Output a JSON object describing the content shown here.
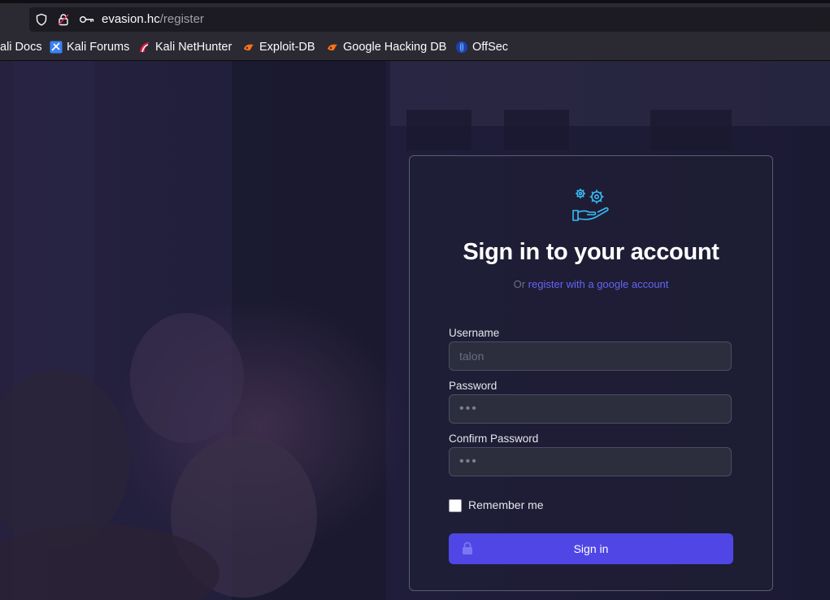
{
  "browser": {
    "url_host": "evasion.hc",
    "url_path": "/register",
    "bookmarks": [
      {
        "label": "ali Docs",
        "icon": "kali-docs-icon"
      },
      {
        "label": "Kali Forums",
        "icon": "kali-forums-icon"
      },
      {
        "label": "Kali NetHunter",
        "icon": "kali-nethunter-icon"
      },
      {
        "label": "Exploit-DB",
        "icon": "exploit-db-icon"
      },
      {
        "label": "Google Hacking DB",
        "icon": "google-hacking-db-icon"
      },
      {
        "label": "OffSec",
        "icon": "offsec-icon"
      }
    ]
  },
  "form": {
    "logo_icon": "gears-hand-icon",
    "title": "Sign in to your account",
    "subtitle_prefix": "Or",
    "subtitle_link": "register with a google account",
    "username_label": "Username",
    "username_placeholder": "talon",
    "password_label": "Password",
    "password_value": "•••",
    "confirm_label": "Confirm Password",
    "confirm_value": "•••",
    "remember_label": "Remember me",
    "remember_checked": false,
    "submit_label": "Sign in"
  },
  "colors": {
    "accent": "#4f46e5",
    "link": "#6366f1",
    "logo": "#38bdf8",
    "page_bg": "#1d1b36"
  }
}
